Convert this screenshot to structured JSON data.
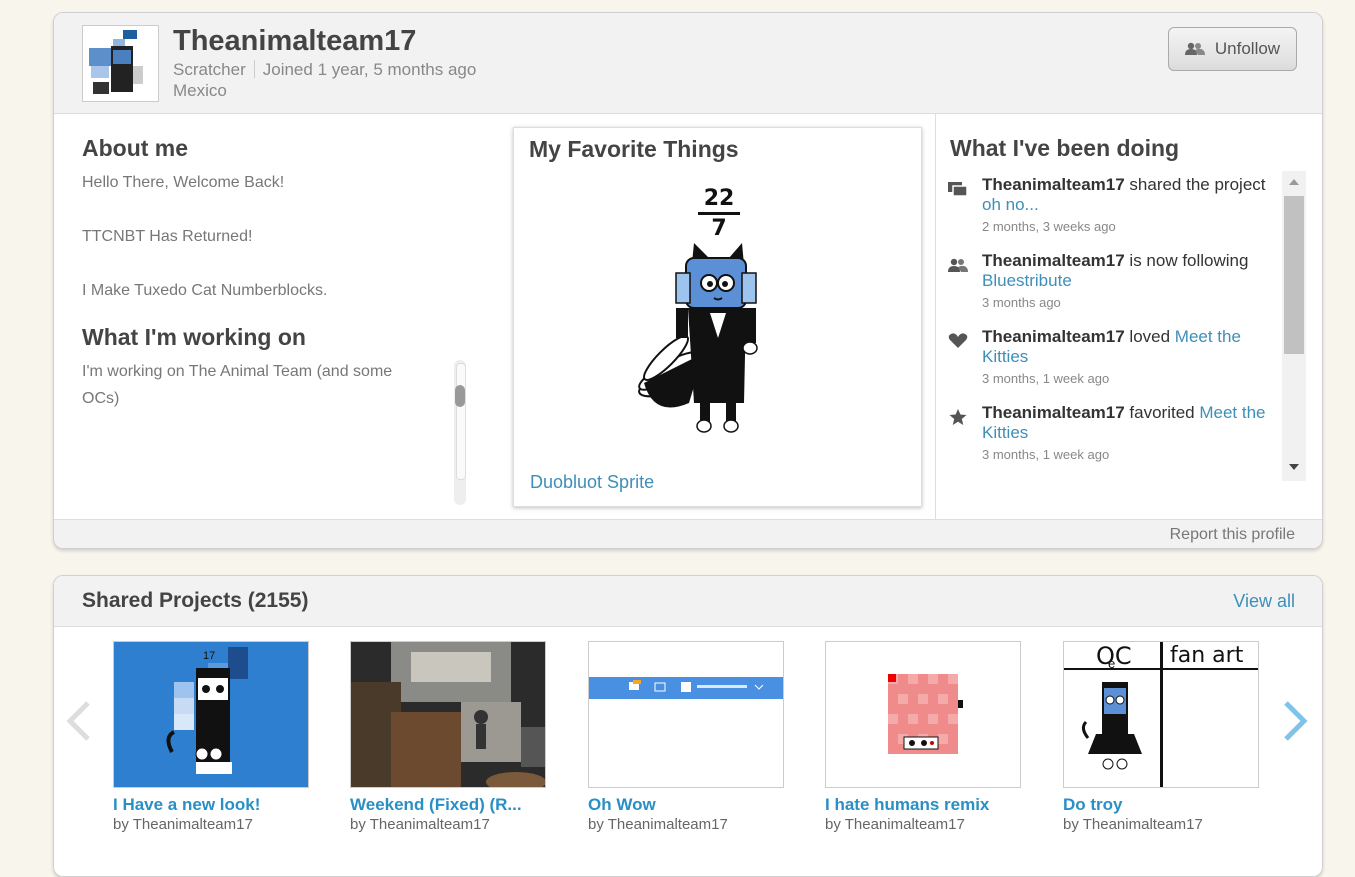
{
  "profile": {
    "username": "Theanimalteam17",
    "role": "Scratcher",
    "joined": "Joined 1 year, 5 months ago",
    "location": "Mexico",
    "unfollow_label": "Unfollow",
    "report_label": "Report this profile"
  },
  "about": {
    "title": "About me",
    "lines": [
      "Hello There, Welcome Back!",
      "TTCNBT Has Returned!",
      "I Make Tuxedo Cat Numberblocks."
    ]
  },
  "working_on": {
    "title": "What I'm working on",
    "text": "I'm working on The Animal Team (and some OCs)"
  },
  "favorites": {
    "title": "My Favorite Things",
    "fraction_top": "22",
    "fraction_bottom": "7",
    "project_link": "Duobluot Sprite"
  },
  "activity": {
    "title": "What I've been doing",
    "items": [
      {
        "icon": "share-icon",
        "user": "Theanimalteam17",
        "action": " shared the project ",
        "target": "oh no...",
        "time": "2 months, 3 weeks ago"
      },
      {
        "icon": "follow-icon",
        "user": "Theanimalteam17",
        "action": " is now following ",
        "target": "Bluestribute",
        "time": "3 months ago"
      },
      {
        "icon": "heart-icon",
        "user": "Theanimalteam17",
        "action": " loved ",
        "target": "Meet the Kitties",
        "time": "3 months, 1 week ago"
      },
      {
        "icon": "star-icon",
        "user": "Theanimalteam17",
        "action": " favorited ",
        "target": "Meet the Kitties",
        "time": "3 months, 1 week ago"
      }
    ]
  },
  "shared": {
    "title": "Shared Projects (2155)",
    "view_all": "View all",
    "projects": [
      {
        "title": "I Have a new look!",
        "by": "by Theanimalteam17"
      },
      {
        "title": "Weekend (Fixed) (R...",
        "by": "by Theanimalteam17"
      },
      {
        "title": "Oh Wow",
        "by": "by Theanimalteam17"
      },
      {
        "title": "I hate humans remix",
        "by": "by Theanimalteam17"
      },
      {
        "title": "Do troy",
        "by": "by Theanimalteam17"
      }
    ],
    "thumb_texts": {
      "number": "17",
      "oc": "OC",
      "oc_e": "e",
      "fan_art": "fan art"
    }
  },
  "colors": {
    "link": "#3d8fb9",
    "project_title": "#2a8fc4",
    "background": "#f7f5ec"
  }
}
